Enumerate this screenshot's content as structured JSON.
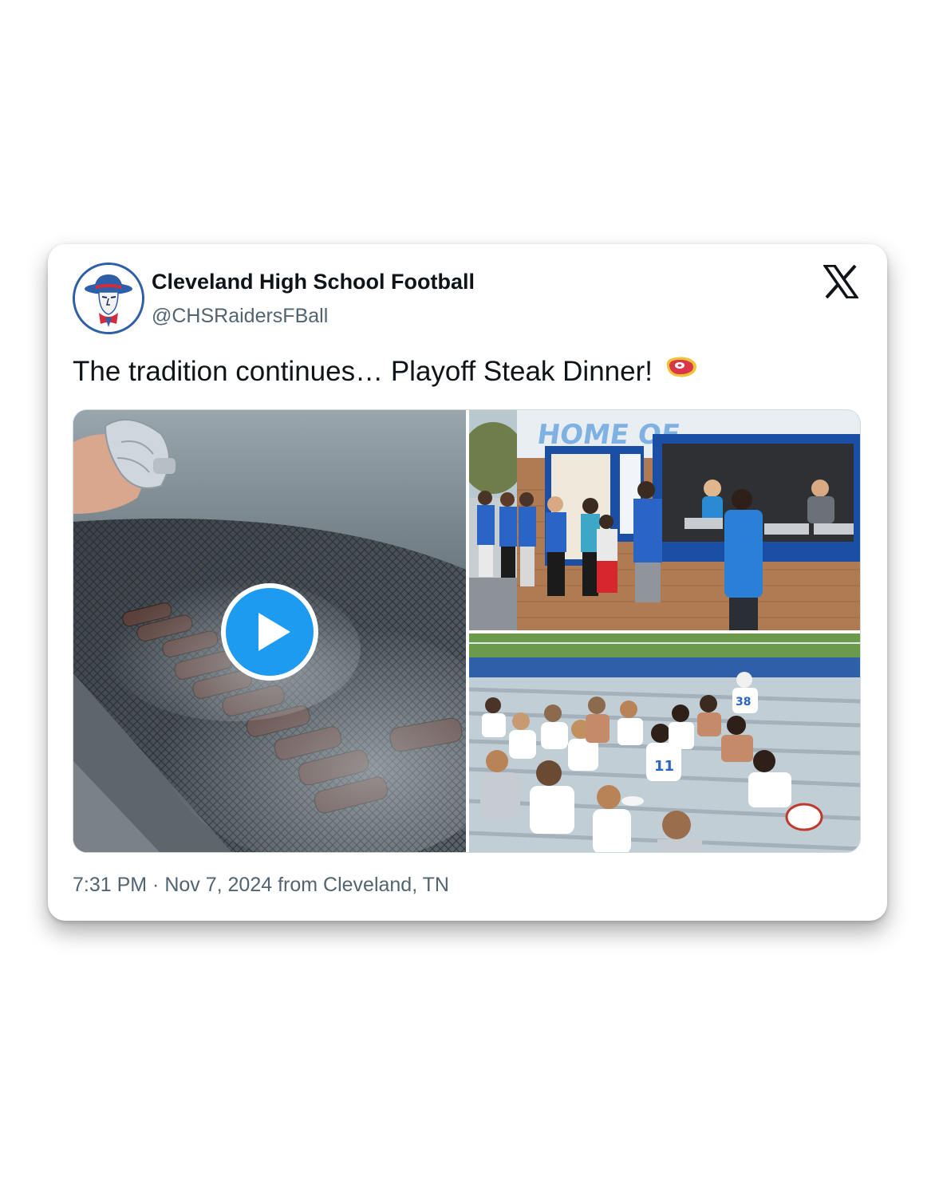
{
  "tweet": {
    "author_name": "Cleveland High School Football",
    "author_handle": "@CHSRaidersFBall",
    "text": "The tradition continues… Playoff Steak Dinner!",
    "emoji_icon": "steak-emoji-icon",
    "timestamp": "7:31 PM · Nov 7, 2024 from Cleveland, TN"
  },
  "media": [
    {
      "kind": "video",
      "icon": "play-icon"
    },
    {
      "kind": "photo"
    },
    {
      "kind": "photo"
    }
  ],
  "colors": {
    "play_button": "#1d9bf0",
    "name_text": "#0f1419",
    "secondary_text": "#536471",
    "avatar_border": "#2f5fa8"
  }
}
